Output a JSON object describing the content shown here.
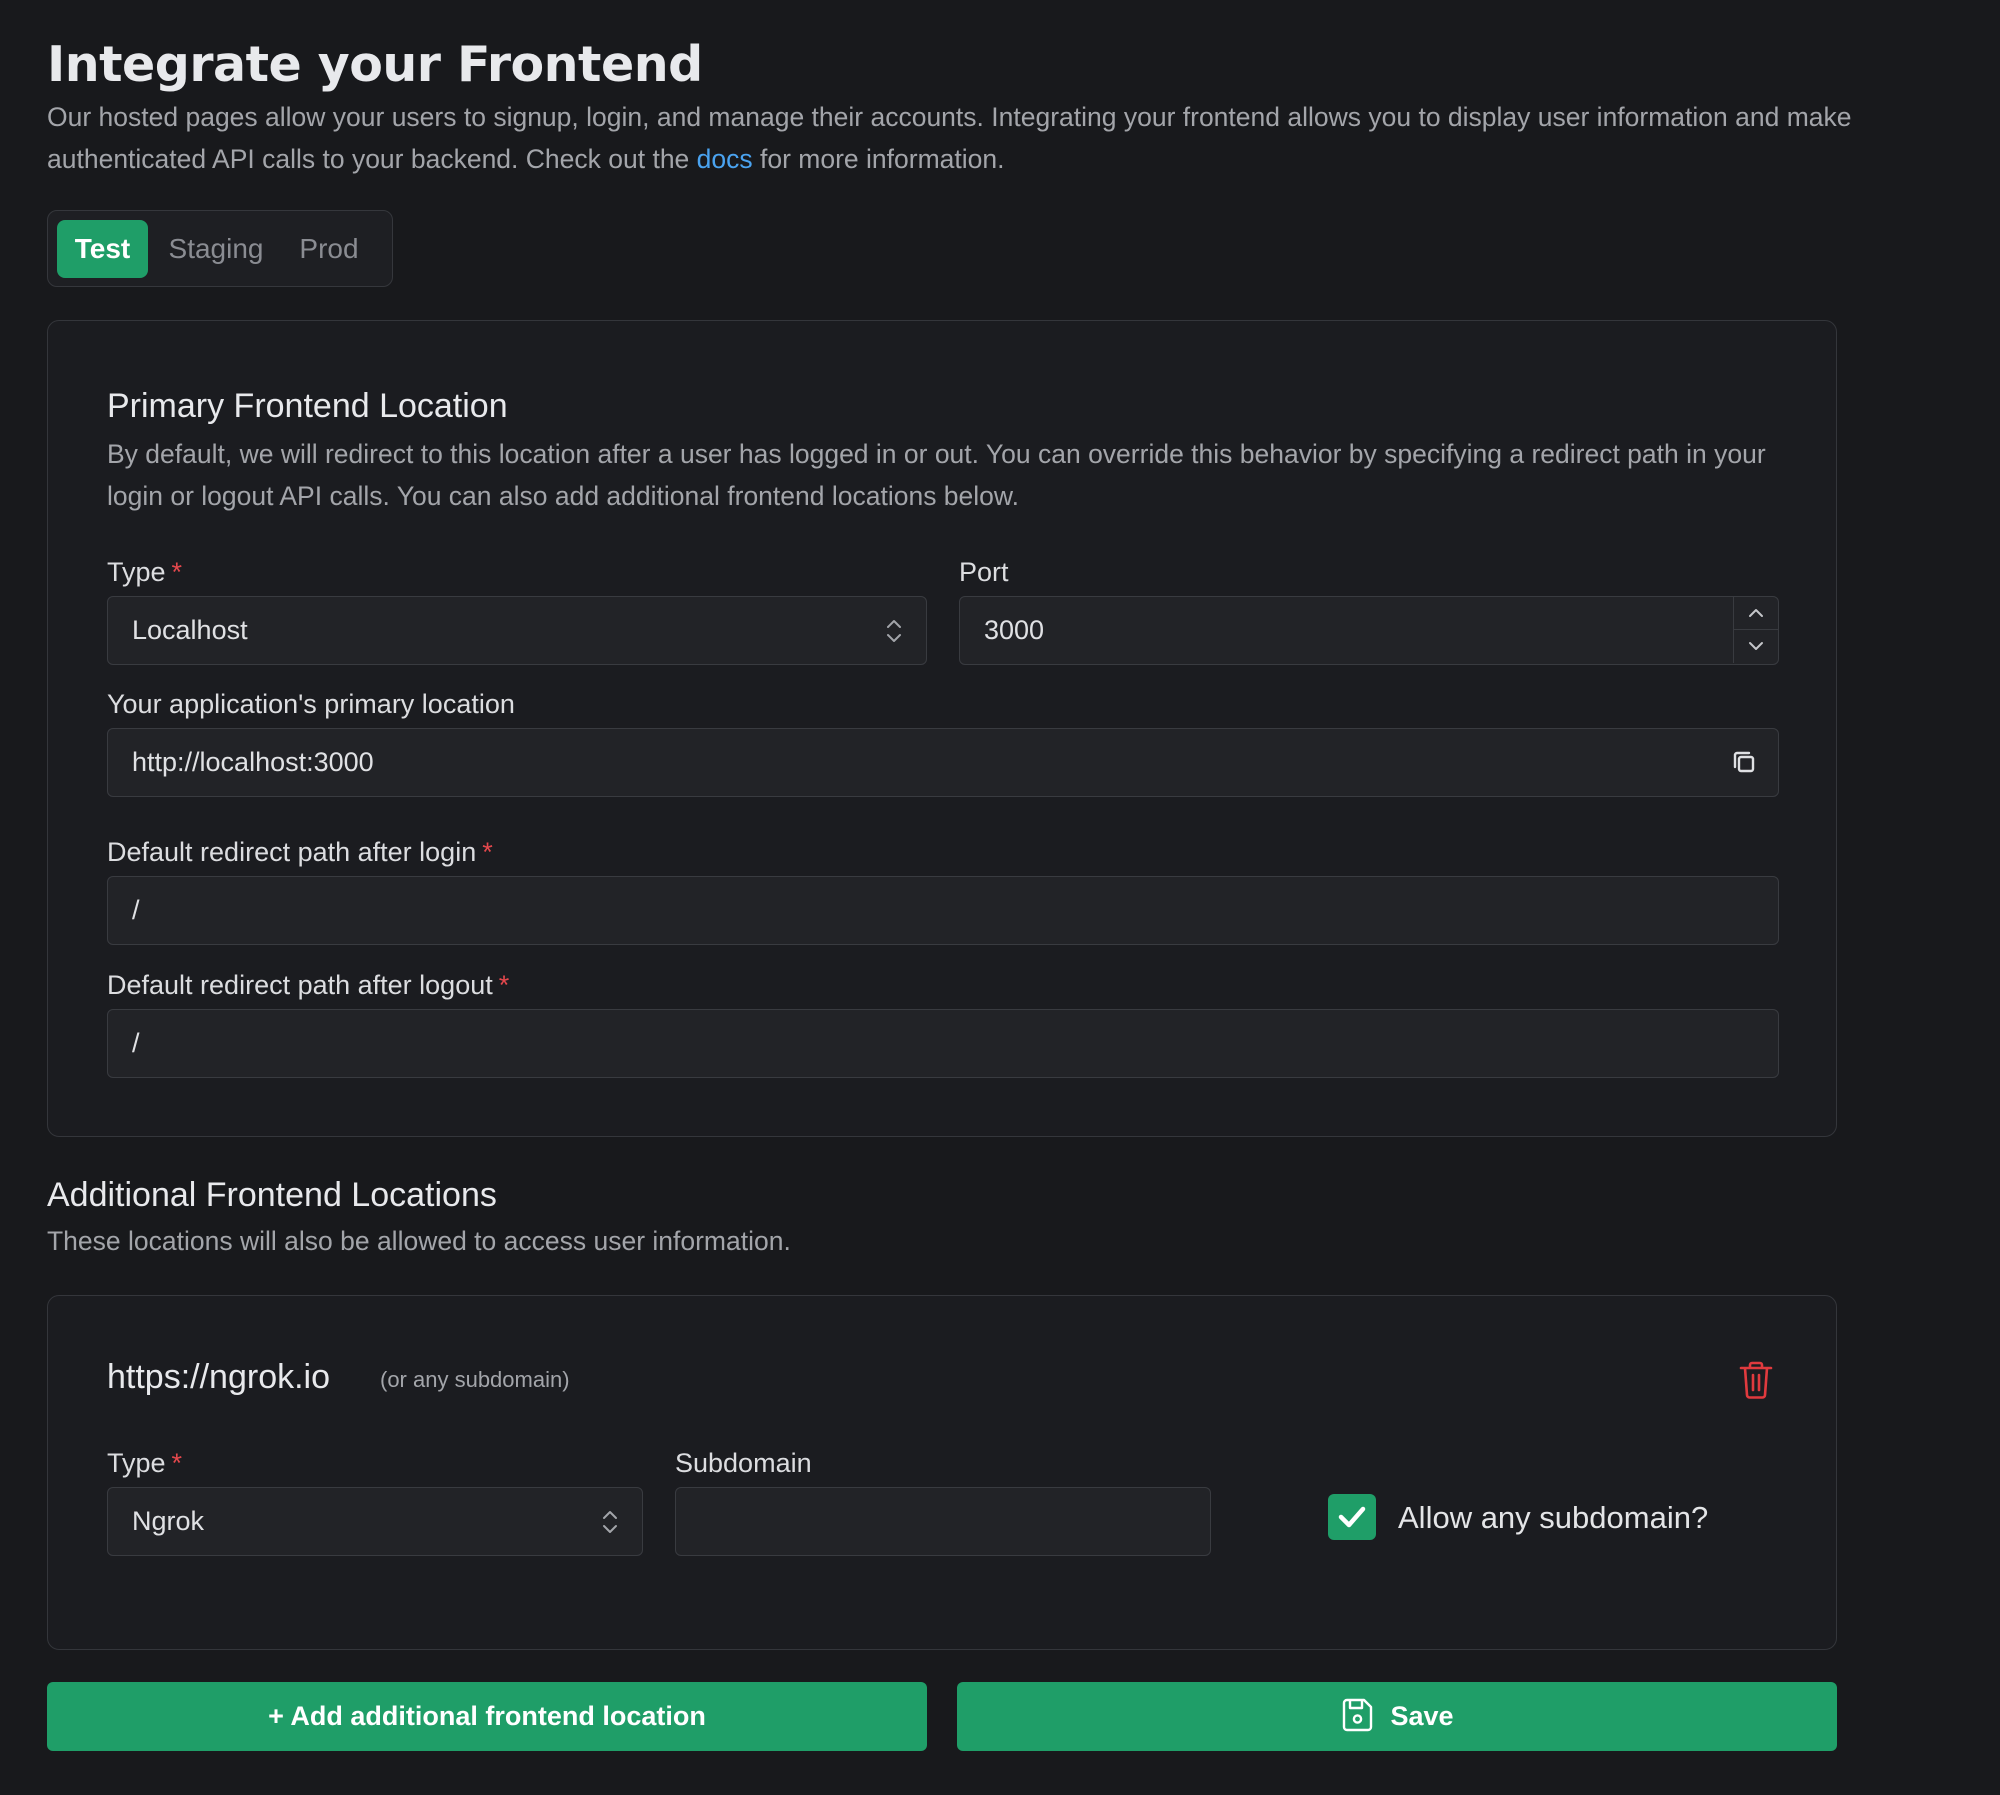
{
  "header": {
    "title": "Integrate your Frontend",
    "description_before_link": "Our hosted pages allow your users to signup, login, and manage their accounts. Integrating your frontend allows you to display user information and make authenticated API calls to your backend. Check out the ",
    "docs_link": "docs",
    "description_after_link": " for more information."
  },
  "env_tabs": {
    "items": [
      {
        "label": "Test",
        "active": true
      },
      {
        "label": "Staging",
        "active": false
      },
      {
        "label": "Prod",
        "active": false
      }
    ]
  },
  "primary": {
    "title": "Primary Frontend Location",
    "description": "By default, we will redirect to this location after a user has logged in or out. You can override this behavior by specifying a redirect path in your login or logout API calls. You can also add additional frontend locations below.",
    "type_label": "Type",
    "type_value": "Localhost",
    "port_label": "Port",
    "port_value": "3000",
    "location_label": "Your application's primary location",
    "location_value": "http://localhost:3000",
    "login_label": "Default redirect path after login",
    "login_value": "/",
    "logout_label": "Default redirect path after logout",
    "logout_value": "/",
    "required_marker": "*"
  },
  "additional": {
    "title": "Additional Frontend Locations",
    "description": "These locations will also be allowed to access user information.",
    "locations": [
      {
        "name": "https://ngrok.io",
        "note": "(or any subdomain)",
        "type_label": "Type",
        "type_value": "Ngrok",
        "subdomain_label": "Subdomain",
        "subdomain_value": "",
        "allow_label": "Allow any subdomain?",
        "allow_checked": true
      }
    ]
  },
  "actions": {
    "add_label": "+ Add additional frontend location",
    "save_label": "Save"
  },
  "colors": {
    "background": "#18191c",
    "accent": "#1f9e68",
    "link": "#4aa3f0",
    "danger": "#e5484d"
  },
  "icons": {
    "select": "chevron-up-down-icon",
    "stepper_up": "chevron-up-icon",
    "stepper_down": "chevron-down-icon",
    "copy": "copy-icon",
    "delete": "trash-icon",
    "check": "check-icon",
    "save": "floppy-disk-icon"
  }
}
